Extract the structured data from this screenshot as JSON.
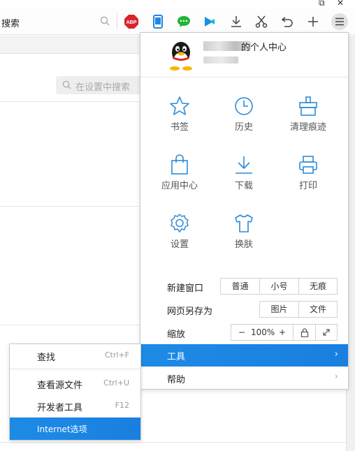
{
  "toolbar": {
    "search_label": "搜索",
    "icons": [
      "search-icon",
      "adblock-icon",
      "phone-icon",
      "wechat-icon",
      "video-icon",
      "download-icon",
      "scissors-icon",
      "undo-icon",
      "add-icon",
      "menu-icon"
    ],
    "abp_label": "ABP"
  },
  "page": {
    "settings_search_placeholder": "在设置中搜索"
  },
  "menu": {
    "profile_title": "的个人中心",
    "grid": [
      {
        "label": "书签",
        "icon": "star-icon"
      },
      {
        "label": "历史",
        "icon": "clock-icon"
      },
      {
        "label": "清理痕迹",
        "icon": "clean-icon"
      },
      {
        "label": "应用中心",
        "icon": "bag-icon"
      },
      {
        "label": "下载",
        "icon": "download-icon"
      },
      {
        "label": "打印",
        "icon": "printer-icon"
      },
      {
        "label": "设置",
        "icon": "gear-icon"
      },
      {
        "label": "换肤",
        "icon": "shirt-icon"
      }
    ],
    "new_window": {
      "label": "新建窗口",
      "options": [
        "普通",
        "小号",
        "无痕"
      ]
    },
    "save_as": {
      "label": "网页另存为",
      "options": [
        "图片",
        "文件"
      ]
    },
    "zoom": {
      "label": "缩放",
      "minus": "−",
      "value": "100%",
      "plus": "+"
    },
    "tools_label": "工具",
    "help_label": "帮助",
    "chevron": "›"
  },
  "submenu": {
    "items": [
      {
        "label": "查找",
        "shortcut": "Ctrl+F"
      },
      {
        "label": "查看源文件",
        "shortcut": "Ctrl+U"
      },
      {
        "label": "开发者工具",
        "shortcut": "F12"
      },
      {
        "label": "Internet选项",
        "shortcut": ""
      }
    ]
  },
  "colors": {
    "accent": "#1a84e3",
    "icon_blue": "#2d8ad8"
  }
}
